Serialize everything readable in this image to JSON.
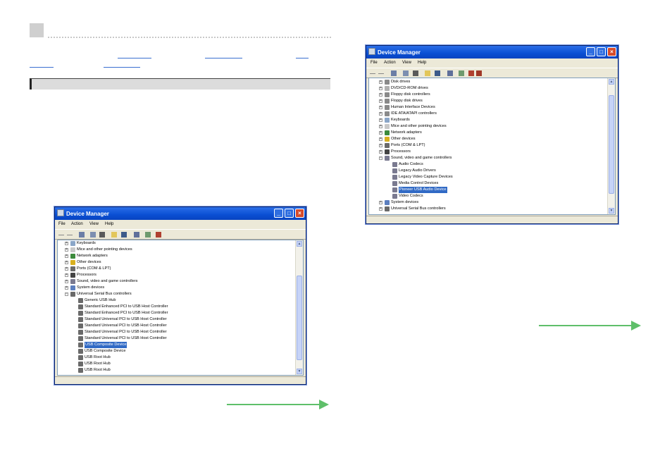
{
  "window_left": {
    "title": "Device Manager",
    "menu": [
      "File",
      "Action",
      "View",
      "Help"
    ],
    "items": [
      {
        "label": "Keyboards",
        "expand": "+",
        "icon": "keyboard-icon",
        "color": "#8aa6c8",
        "level": 0
      },
      {
        "label": "Mice and other pointing devices",
        "expand": "+",
        "icon": "mouse-icon",
        "color": "#c8c8c8",
        "level": 0
      },
      {
        "label": "Network adapters",
        "expand": "+",
        "icon": "network-icon",
        "color": "#3c8a3c",
        "level": 0
      },
      {
        "label": "Other devices",
        "expand": "+",
        "icon": "other-devices-icon",
        "color": "#d8b020",
        "level": 0
      },
      {
        "label": "Ports (COM & LPT)",
        "expand": "+",
        "icon": "port-icon",
        "color": "#6a6a6a",
        "level": 0
      },
      {
        "label": "Processors",
        "expand": "+",
        "icon": "processor-icon",
        "color": "#444444",
        "level": 0
      },
      {
        "label": "Sound, video and game controllers",
        "expand": "+",
        "icon": "sound-icon",
        "color": "#7a7a90",
        "level": 0
      },
      {
        "label": "System devices",
        "expand": "+",
        "icon": "system-icon",
        "color": "#5c7fbf",
        "level": 0
      },
      {
        "label": "Universal Serial Bus controllers",
        "expand": "−",
        "icon": "usb-icon",
        "color": "#6a6a6a",
        "level": 0
      },
      {
        "label": "Generic USB Hub",
        "icon": "usb-icon",
        "color": "#6a6a6a",
        "level": 1
      },
      {
        "label": "Standard Enhanced PCI to USB Host Controller",
        "icon": "usb-icon",
        "color": "#6a6a6a",
        "level": 1
      },
      {
        "label": "Standard Enhanced PCI to USB Host Controller",
        "icon": "usb-icon",
        "color": "#6a6a6a",
        "level": 1
      },
      {
        "label": "Standard Universal PCI to USB Host Controller",
        "icon": "usb-icon",
        "color": "#6a6a6a",
        "level": 1
      },
      {
        "label": "Standard Universal PCI to USB Host Controller",
        "icon": "usb-icon",
        "color": "#6a6a6a",
        "level": 1
      },
      {
        "label": "Standard Universal PCI to USB Host Controller",
        "icon": "usb-icon",
        "color": "#6a6a6a",
        "level": 1
      },
      {
        "label": "Standard Universal PCI to USB Host Controller",
        "icon": "usb-icon",
        "color": "#6a6a6a",
        "level": 1
      },
      {
        "label": "USB Composite Device",
        "icon": "usb-icon",
        "color": "#6a6a6a",
        "level": 1,
        "selected": true
      },
      {
        "label": "USB Composite Device",
        "icon": "usb-icon",
        "color": "#6a6a6a",
        "level": 1
      },
      {
        "label": "USB Root Hub",
        "icon": "usb-icon",
        "color": "#6a6a6a",
        "level": 1
      },
      {
        "label": "USB Root Hub",
        "icon": "usb-icon",
        "color": "#6a6a6a",
        "level": 1
      },
      {
        "label": "USB Root Hub",
        "icon": "usb-icon",
        "color": "#6a6a6a",
        "level": 1
      }
    ]
  },
  "window_right": {
    "title": "Device Manager",
    "menu": [
      "File",
      "Action",
      "View",
      "Help"
    ],
    "items": [
      {
        "label": "Disk drives",
        "expand": "+",
        "icon": "disk-icon",
        "color": "#8a8a8a",
        "level": 0
      },
      {
        "label": "DVD/CD-ROM drives",
        "expand": "+",
        "icon": "cdrom-icon",
        "color": "#b0b0b0",
        "level": 0
      },
      {
        "label": "Floppy disk controllers",
        "expand": "+",
        "icon": "floppy-controller-icon",
        "color": "#8a8a8a",
        "level": 0
      },
      {
        "label": "Floppy disk drives",
        "expand": "+",
        "icon": "floppy-icon",
        "color": "#8a8a8a",
        "level": 0
      },
      {
        "label": "Human Interface Devices",
        "expand": "+",
        "icon": "hid-icon",
        "color": "#8a8a8a",
        "level": 0
      },
      {
        "label": "IDE ATA/ATAPI controllers",
        "expand": "+",
        "icon": "ide-icon",
        "color": "#8a8a8a",
        "level": 0
      },
      {
        "label": "Keyboards",
        "expand": "+",
        "icon": "keyboard-icon",
        "color": "#8aa6c8",
        "level": 0
      },
      {
        "label": "Mice and other pointing devices",
        "expand": "+",
        "icon": "mouse-icon",
        "color": "#c8c8c8",
        "level": 0
      },
      {
        "label": "Network adapters",
        "expand": "+",
        "icon": "network-icon",
        "color": "#3c8a3c",
        "level": 0
      },
      {
        "label": "Other devices",
        "expand": "+",
        "icon": "other-devices-icon",
        "color": "#d8b020",
        "level": 0
      },
      {
        "label": "Ports (COM & LPT)",
        "expand": "+",
        "icon": "port-icon",
        "color": "#6a6a6a",
        "level": 0
      },
      {
        "label": "Processors",
        "expand": "+",
        "icon": "processor-icon",
        "color": "#444444",
        "level": 0
      },
      {
        "label": "Sound, video and game controllers",
        "expand": "−",
        "icon": "sound-icon",
        "color": "#7a7a90",
        "level": 0
      },
      {
        "label": "Audio Codecs",
        "icon": "sound-icon",
        "color": "#7a7a90",
        "level": 1
      },
      {
        "label": "Legacy Audio Drivers",
        "icon": "sound-icon",
        "color": "#7a7a90",
        "level": 1
      },
      {
        "label": "Legacy Video Capture Devices",
        "icon": "sound-icon",
        "color": "#7a7a90",
        "level": 1
      },
      {
        "label": "Media Control Devices",
        "icon": "sound-icon",
        "color": "#7a7a90",
        "level": 1
      },
      {
        "label": "Pioneer USB Audio Device",
        "icon": "sound-icon",
        "color": "#7a7a90",
        "level": 1,
        "selected": true
      },
      {
        "label": "Video Codecs",
        "icon": "sound-icon",
        "color": "#7a7a90",
        "level": 1
      },
      {
        "label": "System devices",
        "expand": "+",
        "icon": "system-icon",
        "color": "#5c7fbf",
        "level": 0
      },
      {
        "label": "Universal Serial Bus controllers",
        "expand": "+",
        "icon": "usb-icon",
        "color": "#6a6a6a",
        "level": 0
      }
    ]
  },
  "colors": {
    "accent_green": "#5fbf6a",
    "titlebar_blue": "#0a4fd3",
    "selection_blue": "#316ac5"
  }
}
